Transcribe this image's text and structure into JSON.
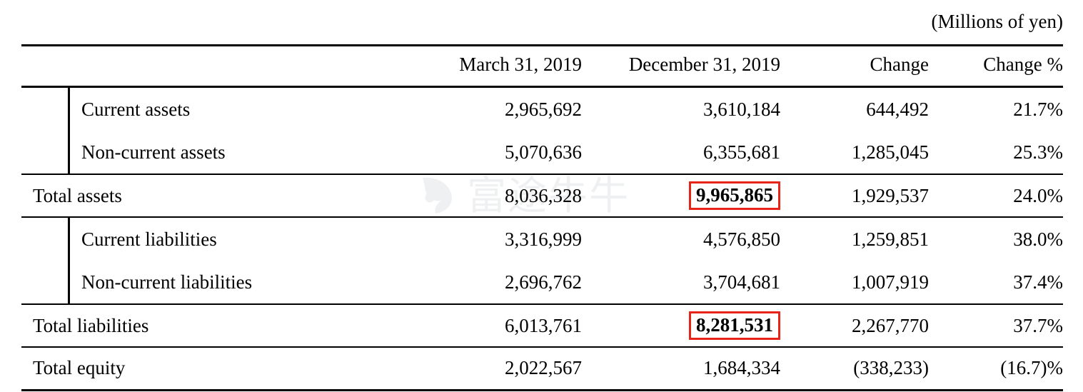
{
  "units_caption": "(Millions of yen)",
  "watermark": {
    "text": "富途牛牛",
    "logo_icon": "futu-logo-icon"
  },
  "accent_colors": {
    "highlight_box": "#e8241a",
    "rule": "#000000",
    "watermark": "#d9dade"
  },
  "table": {
    "columns": [
      {
        "key": "label",
        "header": ""
      },
      {
        "key": "prev",
        "header": "March 31, 2019"
      },
      {
        "key": "current",
        "header": "December 31, 2019"
      },
      {
        "key": "change",
        "header": "Change"
      },
      {
        "key": "change_pct",
        "header": "Change %"
      }
    ],
    "rows": [
      {
        "label": "Current assets",
        "prev": "2,965,692",
        "current": "3,610,184",
        "change": "644,492",
        "change_pct": "21.7%"
      },
      {
        "label": "Non-current assets",
        "prev": "5,070,636",
        "current": "6,355,681",
        "change": "1,285,045",
        "change_pct": "25.3%"
      },
      {
        "label": "Total assets",
        "prev": "8,036,328",
        "current": "9,965,865",
        "change": "1,929,537",
        "change_pct": "24.0%"
      },
      {
        "label": "Current liabilities",
        "prev": "3,316,999",
        "current": "4,576,850",
        "change": "1,259,851",
        "change_pct": "38.0%"
      },
      {
        "label": "Non-current liabilities",
        "prev": "2,696,762",
        "current": "3,704,681",
        "change": "1,007,919",
        "change_pct": "37.4%"
      },
      {
        "label": "Total liabilities",
        "prev": "6,013,761",
        "current": "8,281,531",
        "change": "2,267,770",
        "change_pct": "37.7%"
      },
      {
        "label": "Total equity",
        "prev": "2,022,567",
        "current": "1,684,334",
        "change": "(338,233)",
        "change_pct": "(16.7)%"
      }
    ]
  }
}
